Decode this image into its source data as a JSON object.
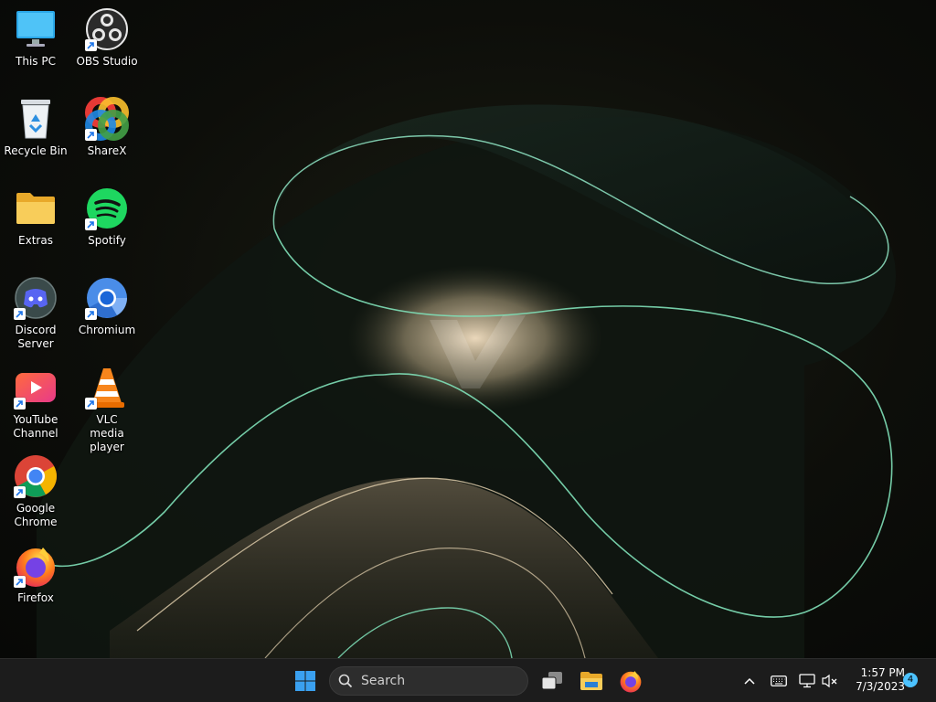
{
  "desktop": {
    "icons": [
      {
        "label": "This PC",
        "icon": "this-pc-icon"
      },
      {
        "label": "OBS Studio",
        "icon": "obs-studio-icon"
      },
      {
        "label": "Recycle Bin",
        "icon": "recycle-bin-icon"
      },
      {
        "label": "ShareX",
        "icon": "sharex-icon"
      },
      {
        "label": "Extras",
        "icon": "folder-icon"
      },
      {
        "label": "Spotify",
        "icon": "spotify-icon"
      },
      {
        "label": "Discord Server",
        "icon": "discord-icon"
      },
      {
        "label": "Chromium",
        "icon": "chromium-icon"
      },
      {
        "label": "YouTube Channel",
        "icon": "youtube-icon"
      },
      {
        "label": "VLC media player",
        "icon": "vlc-icon"
      },
      {
        "label": "Google Chrome",
        "icon": "chrome-icon"
      },
      {
        "label": "Firefox",
        "icon": "firefox-icon"
      }
    ]
  },
  "taskbar": {
    "search_placeholder": "Search",
    "pinned": [
      "start-icon",
      "task-view-icon",
      "file-explorer-icon",
      "firefox-icon"
    ],
    "tray": {
      "time": "1:57 PM",
      "date": "7/3/2023",
      "notification_count": "4"
    }
  },
  "colors": {
    "taskbar_bg": "#1c1c1c",
    "accent": "#4cc2ff",
    "wallpaper_line": "#7fe0b8"
  }
}
